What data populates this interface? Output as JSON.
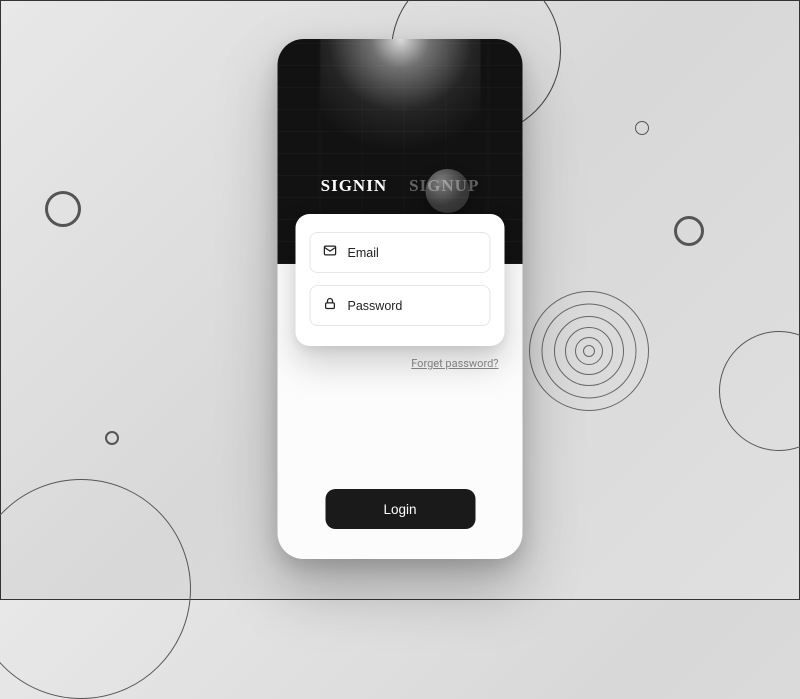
{
  "tabs": {
    "signin": "SIGNIN",
    "signup": "SIGNUP"
  },
  "form": {
    "email_placeholder": "Email",
    "password_placeholder": "Password"
  },
  "links": {
    "forgot": "Forget password?"
  },
  "buttons": {
    "login": "Login"
  }
}
